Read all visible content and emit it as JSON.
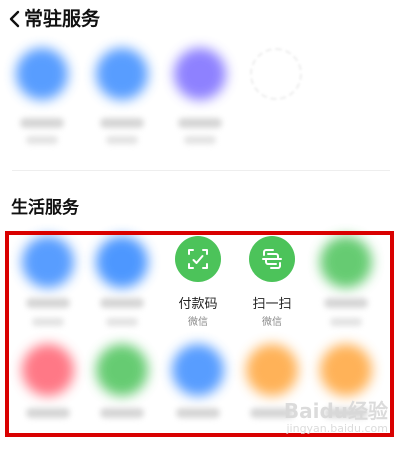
{
  "header": {
    "title": "常驻服务",
    "back_icon": "chevron-left-icon"
  },
  "sections": {
    "life_services_title": "生活服务"
  },
  "services": {
    "payment_code": {
      "label": "付款码",
      "source": "微信",
      "icon": "scan-frame-icon",
      "color": "#4cc35a"
    },
    "scan": {
      "label": "扫一扫",
      "source": "微信",
      "icon": "scan-icon",
      "color": "#4cc35a"
    }
  },
  "colors": {
    "accent_blue": "#3b8cff",
    "accent_green": "#4cc35a",
    "accent_purple": "#7b6cff",
    "accent_red": "#ff6171",
    "accent_orange": "#ffa53b",
    "highlight_border": "#d90000"
  },
  "watermark": {
    "text": "Baidu经验",
    "sub": "jingyan.baidu.com"
  }
}
